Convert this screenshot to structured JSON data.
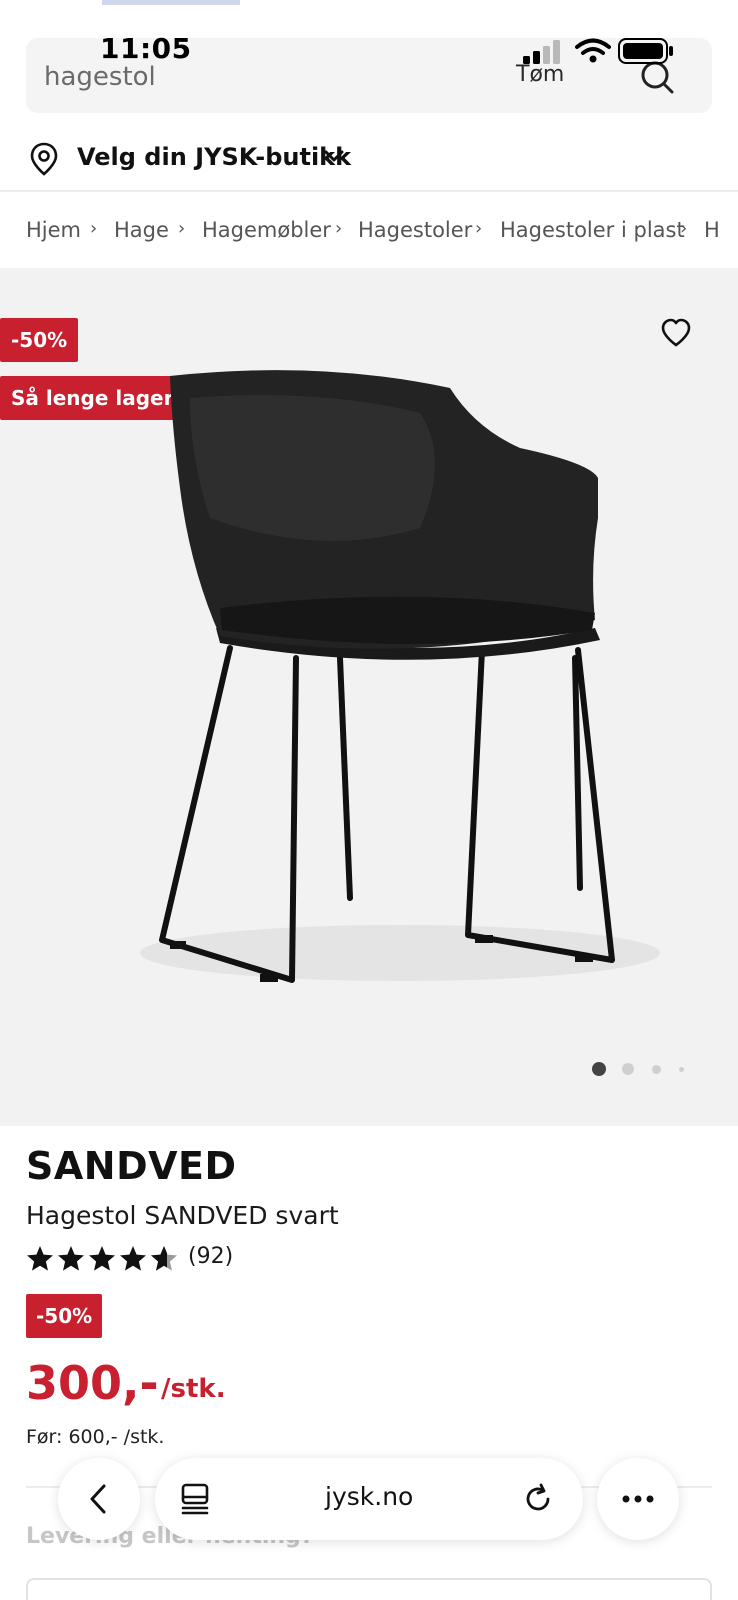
{
  "status_bar": {
    "time": "11:05"
  },
  "search": {
    "query": "hagestol",
    "clear_label": "Tøm",
    "search_icon": "search-icon"
  },
  "store_selector": {
    "label": "Velg din JYSK-butikk",
    "icon": "location-pin-icon"
  },
  "breadcrumb": {
    "items": [
      "Hjem",
      "Hage",
      "Hagemøbler",
      "Hagestoler",
      "Hagestoler i plast",
      "H"
    ]
  },
  "gallery": {
    "discount_badge": "-50%",
    "stock_badge": "Så lenge lageret rekker",
    "favorite_icon": "heart-icon",
    "image_count": 4,
    "active_image": 1
  },
  "product": {
    "brand": "SANDVED",
    "title": "Hagestol SANDVED svart",
    "rating": 4.7,
    "review_count": "(92)",
    "discount_badge": "-50%",
    "price": "300,-",
    "price_unit": "/stk.",
    "old_price": "Før: 600,- /stk.",
    "delivery_label": "Levering eller henting?"
  },
  "browser": {
    "url": "jysk.no",
    "back_icon": "chevron-left-icon",
    "tabs_icon": "tabs-icon",
    "reload_icon": "reload-icon",
    "more_icon": "more-icon"
  },
  "colors": {
    "accent_red": "#c8202f",
    "gallery_bg": "#f2f2f2"
  }
}
